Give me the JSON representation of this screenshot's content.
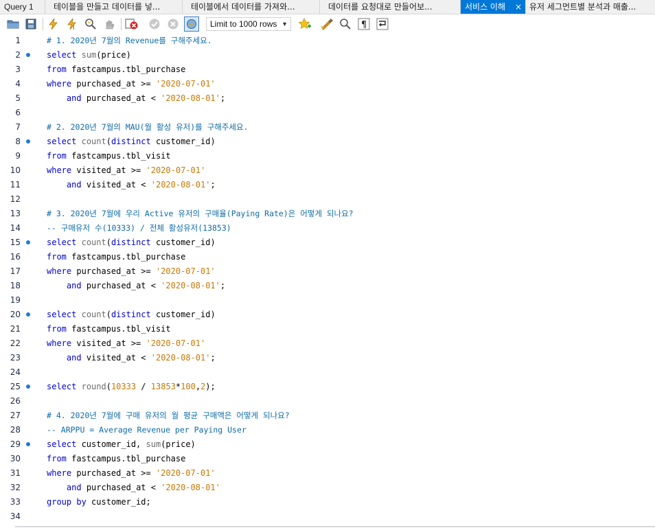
{
  "tabs": [
    {
      "label": "Query 1",
      "active": false
    },
    {
      "label": "테이블을 만들고 데이터를 넣...",
      "active": false
    },
    {
      "label": "테이블에서 데이터를 가져와...",
      "active": false
    },
    {
      "label": "데이터를 요청대로 만들어보...",
      "active": false
    },
    {
      "label": "서비스 이해",
      "active": true,
      "close": "×"
    },
    {
      "label": "유저 세그먼트별 분석과 매출...",
      "active": false
    }
  ],
  "toolbar": {
    "limit_label": "Limit to 1000 rows",
    "icons": [
      "open-folder-icon",
      "save-icon",
      "execute-icon",
      "execute-current-icon",
      "explain-icon",
      "stop-icon",
      "toggle-error-stop-icon",
      "commit-icon",
      "rollback-icon",
      "autocommit-icon",
      "limit-rows-select",
      "add-snippet-icon",
      "beautify-icon",
      "find-icon",
      "invisible-chars-icon",
      "wrap-icon"
    ]
  },
  "editor": {
    "lines": [
      {
        "n": "1",
        "marker": false,
        "code": "# 1. 2020년 7월의 Revenue를 구해주세요."
      },
      {
        "n": "2",
        "marker": true,
        "code": "select sum(price)"
      },
      {
        "n": "3",
        "marker": false,
        "code": "from fastcampus.tbl_purchase"
      },
      {
        "n": "4",
        "marker": false,
        "code": "where purchased_at >= '2020-07-01'"
      },
      {
        "n": "5",
        "marker": false,
        "code": "    and purchased_at < '2020-08-01';"
      },
      {
        "n": "6",
        "marker": false,
        "code": ""
      },
      {
        "n": "7",
        "marker": false,
        "code": "# 2. 2020년 7월의 MAU(월 활성 유저)를 구해주세요."
      },
      {
        "n": "8",
        "marker": true,
        "code": "select count(distinct customer_id)"
      },
      {
        "n": "9",
        "marker": false,
        "code": "from fastcampus.tbl_visit"
      },
      {
        "n": "10",
        "marker": false,
        "code": "where visited_at >= '2020-07-01'"
      },
      {
        "n": "11",
        "marker": false,
        "code": "    and visited_at < '2020-08-01';"
      },
      {
        "n": "12",
        "marker": false,
        "code": ""
      },
      {
        "n": "13",
        "marker": false,
        "code": "# 3. 2020년 7월에 우리 Active 유저의 구매율(Paying Rate)은 어떻게 되나요?"
      },
      {
        "n": "14",
        "marker": false,
        "code": "-- 구매유저 수(10333) / 전체 활성유저(13853)"
      },
      {
        "n": "15",
        "marker": true,
        "code": "select count(distinct customer_id)"
      },
      {
        "n": "16",
        "marker": false,
        "code": "from fastcampus.tbl_purchase"
      },
      {
        "n": "17",
        "marker": false,
        "code": "where purchased_at >= '2020-07-01'"
      },
      {
        "n": "18",
        "marker": false,
        "code": "    and purchased_at < '2020-08-01';"
      },
      {
        "n": "19",
        "marker": false,
        "code": ""
      },
      {
        "n": "20",
        "marker": true,
        "code": "select count(distinct customer_id)"
      },
      {
        "n": "21",
        "marker": false,
        "code": "from fastcampus.tbl_visit"
      },
      {
        "n": "22",
        "marker": false,
        "code": "where visited_at >= '2020-07-01'"
      },
      {
        "n": "23",
        "marker": false,
        "code": "    and visited_at < '2020-08-01';"
      },
      {
        "n": "24",
        "marker": false,
        "code": ""
      },
      {
        "n": "25",
        "marker": true,
        "code": "select round(10333 / 13853*100,2);"
      },
      {
        "n": "26",
        "marker": false,
        "code": ""
      },
      {
        "n": "27",
        "marker": false,
        "code": "# 4. 2020년 7월에 구매 유저의 월 평균 구매액은 어떻게 되나요?"
      },
      {
        "n": "28",
        "marker": false,
        "code": "-- ARPPU = Average Revenue per Paying User"
      },
      {
        "n": "29",
        "marker": true,
        "code": "select customer_id, sum(price)"
      },
      {
        "n": "30",
        "marker": false,
        "code": "from fastcampus.tbl_purchase"
      },
      {
        "n": "31",
        "marker": false,
        "code": "where purchased_at >= '2020-07-01'"
      },
      {
        "n": "32",
        "marker": false,
        "code": "    and purchased_at < '2020-08-01'"
      },
      {
        "n": "33",
        "marker": false,
        "code": "group by customer_id;"
      },
      {
        "n": "34",
        "marker": false,
        "code": ""
      }
    ]
  },
  "colors": {
    "keyword": "#0000d0",
    "function": "#6b6b6b",
    "string": "#c87800",
    "comment": "#0d6aa8",
    "marker": "#1e7ad6",
    "active_tab": "#0078d7"
  }
}
